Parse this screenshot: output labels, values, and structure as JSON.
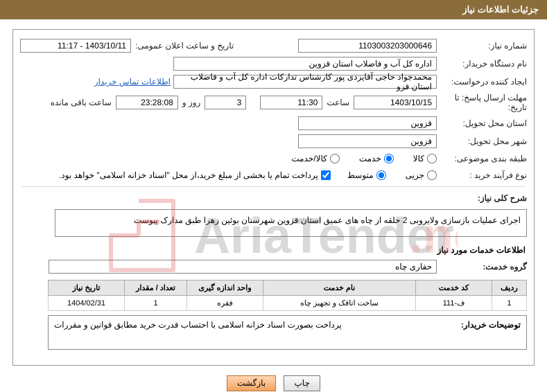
{
  "header": {
    "title": "جزئیات اطلاعات نیاز"
  },
  "fields": {
    "need_number_label": "شماره نیاز:",
    "need_number": "1103003203000646",
    "announce_label": "تاریخ و ساعت اعلان عمومی:",
    "announce_value": "1403/10/11 - 11:17",
    "buyer_org_label": "نام دستگاه خریدار:",
    "buyer_org": "اداره کل آب و فاضلاب استان قزوین",
    "requester_label": "ایجاد کننده درخواست:",
    "requester": "محمدجواد حاجی آقایزدی پور کارشناس تدارکات اداره کل آب و فاضلاب استان قزو",
    "contact_link": "اطلاعات تماس خریدار",
    "deadline_label": "مهلت ارسال پاسخ: تا تاریخ:",
    "deadline_date": "1403/10/15",
    "time_label": "ساعت",
    "deadline_time": "11:30",
    "days": "3",
    "days_label": "روز و",
    "countdown": "23:28:08",
    "remaining_label": "ساعت باقی مانده",
    "delivery_province_label": "استان محل تحویل:",
    "delivery_province": "قزوین",
    "delivery_city_label": "شهر محل تحویل:",
    "delivery_city": "قزوین",
    "category_label": "طبقه بندی موضوعی:",
    "cat_goods": "کالا",
    "cat_service": "خدمت",
    "cat_goods_service": "کالا/خدمت",
    "process_type_label": "نوع فرآیند خرید :",
    "proc_minor": "جزیی",
    "proc_medium": "متوسط",
    "payment_note": "پرداخت تمام یا بخشی از مبلغ خرید،از محل \"اسناد خزانه اسلامی\" خواهد بود.",
    "overview_label": "شرح کلی نیاز:",
    "overview_text": "اجرای عملیات بازسازی ولایروبی 2  حلقه از چاه های عمیق استان قزوین  شهرستان بوئین زهرا طبق مدارک پیوست",
    "services_header": "اطلاعات خدمات مورد نیاز",
    "service_group_label": "گروه خدمت:",
    "service_group": "حفاری چاه",
    "buyer_notes_label": "توضیحات خریدار:",
    "buyer_notes": "پرداخت بصورت اسناد خزانه اسلامی با احتساب قدرت خرید مطابق قوانین و مقررات"
  },
  "table": {
    "headers": {
      "row": "ردیف",
      "code": "کد خدمت",
      "name": "نام خدمت",
      "unit": "واحد اندازه گیری",
      "qty": "تعداد / مقدار",
      "date": "تاریخ نیاز"
    },
    "rows": [
      {
        "row": "1",
        "code": "ف-111",
        "name": "ساخت اتاقک و تجهیز چاه",
        "unit": "فقره",
        "qty": "1",
        "date": "1404/02/31"
      }
    ]
  },
  "buttons": {
    "print": "چاپ",
    "back": "بازگشت"
  }
}
